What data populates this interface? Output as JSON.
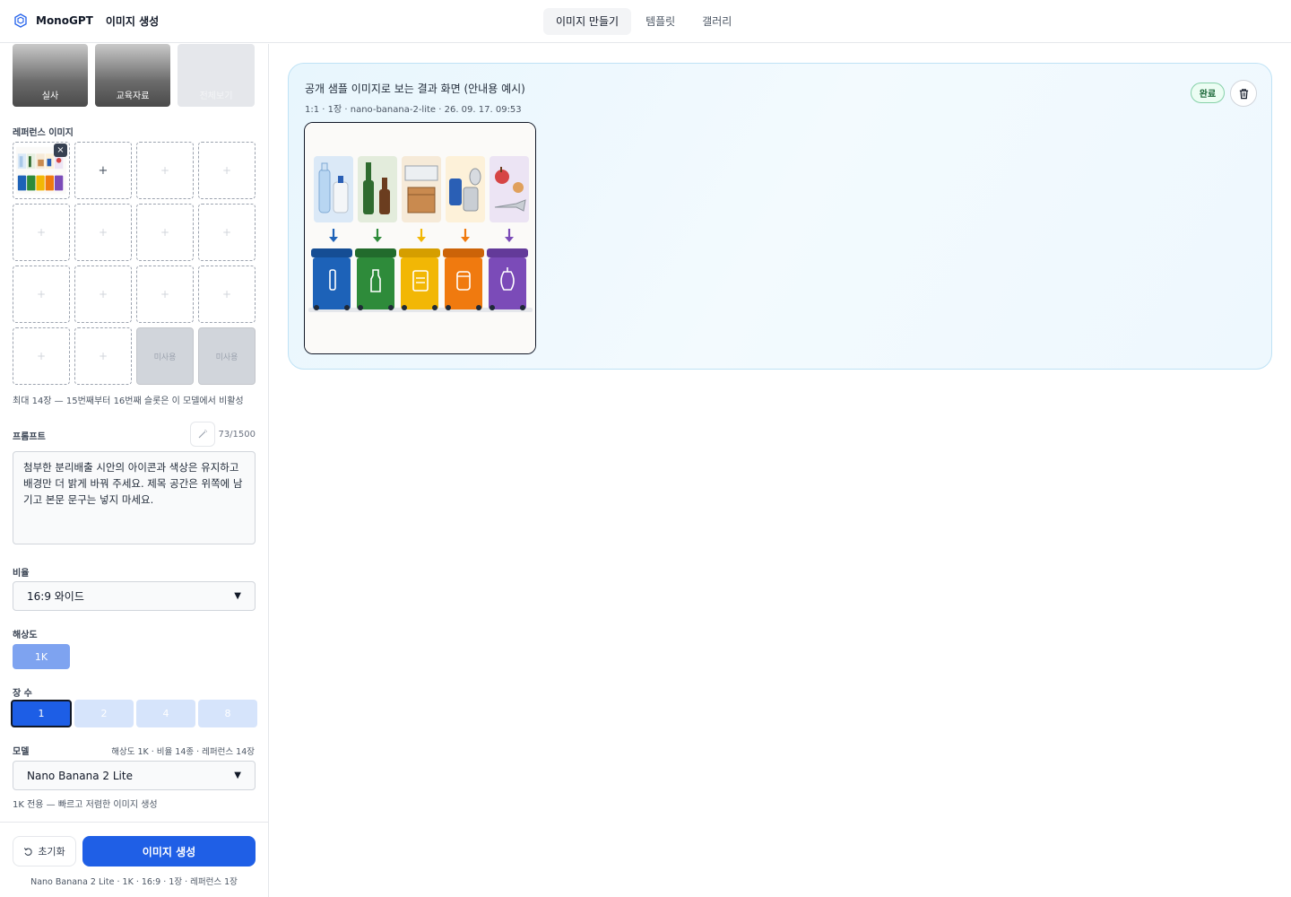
{
  "header": {
    "brand": "MonoGPT",
    "section": "이미지 생성",
    "tabs": [
      {
        "label": "이미지 만들기",
        "active": true
      },
      {
        "label": "템플릿",
        "active": false
      },
      {
        "label": "갤러리",
        "active": false
      }
    ]
  },
  "sidebar": {
    "templates": [
      "실사",
      "교육자료",
      "전체보기"
    ],
    "reference": {
      "label": "레퍼런스 이미지",
      "add_symbol": "+",
      "remove_symbol": "×",
      "unused_label": "미사용",
      "hint": "최대 14장 — 15번째부터 16번째 슬롯은 이 모델에서 비활성"
    },
    "prompt": {
      "label": "프롬프트",
      "counter": "73/1500",
      "text": "첨부한 분리배출 시안의 아이콘과 색상은 유지하고 배경만 더 밝게 바꿔 주세요. 제목 공간은 위쪽에 남기고 본문 문구는 넣지 마세요."
    },
    "ratio": {
      "label": "비율",
      "value": "16:9 와이드"
    },
    "resolution": {
      "label": "해상도",
      "value": "1K"
    },
    "count": {
      "label": "장 수",
      "options": [
        "1",
        "2",
        "4",
        "8"
      ],
      "selected": "1"
    },
    "model": {
      "label": "모델",
      "meta": "해상도 1K · 비율 14종 · 레퍼런스 14장",
      "value": "Nano Banana 2 Lite",
      "hint": "1K 전용 — 빠르고 저렴한 이미지 생성"
    },
    "footer": {
      "reset_label": "초기화",
      "generate_label": "이미지 생성",
      "summary": "Nano Banana 2 Lite · 1K · 16:9 · 1장 · 레퍼런스 1장"
    }
  },
  "result": {
    "title": "공개 샘플 이미지로 보는 결과 화면 (안내용 예시)",
    "meta": "1:1 · 1장 · nano-banana-2-lite · 26. 09. 17. 09:53",
    "status": "완료"
  },
  "colors": {
    "accent": "#1f5fe6",
    "bin_blue": "#1d62b8",
    "bin_green": "#2e8b3a",
    "bin_yellow": "#f2b705",
    "bin_orange": "#f07a0f",
    "bin_purple": "#7b4bb8"
  }
}
